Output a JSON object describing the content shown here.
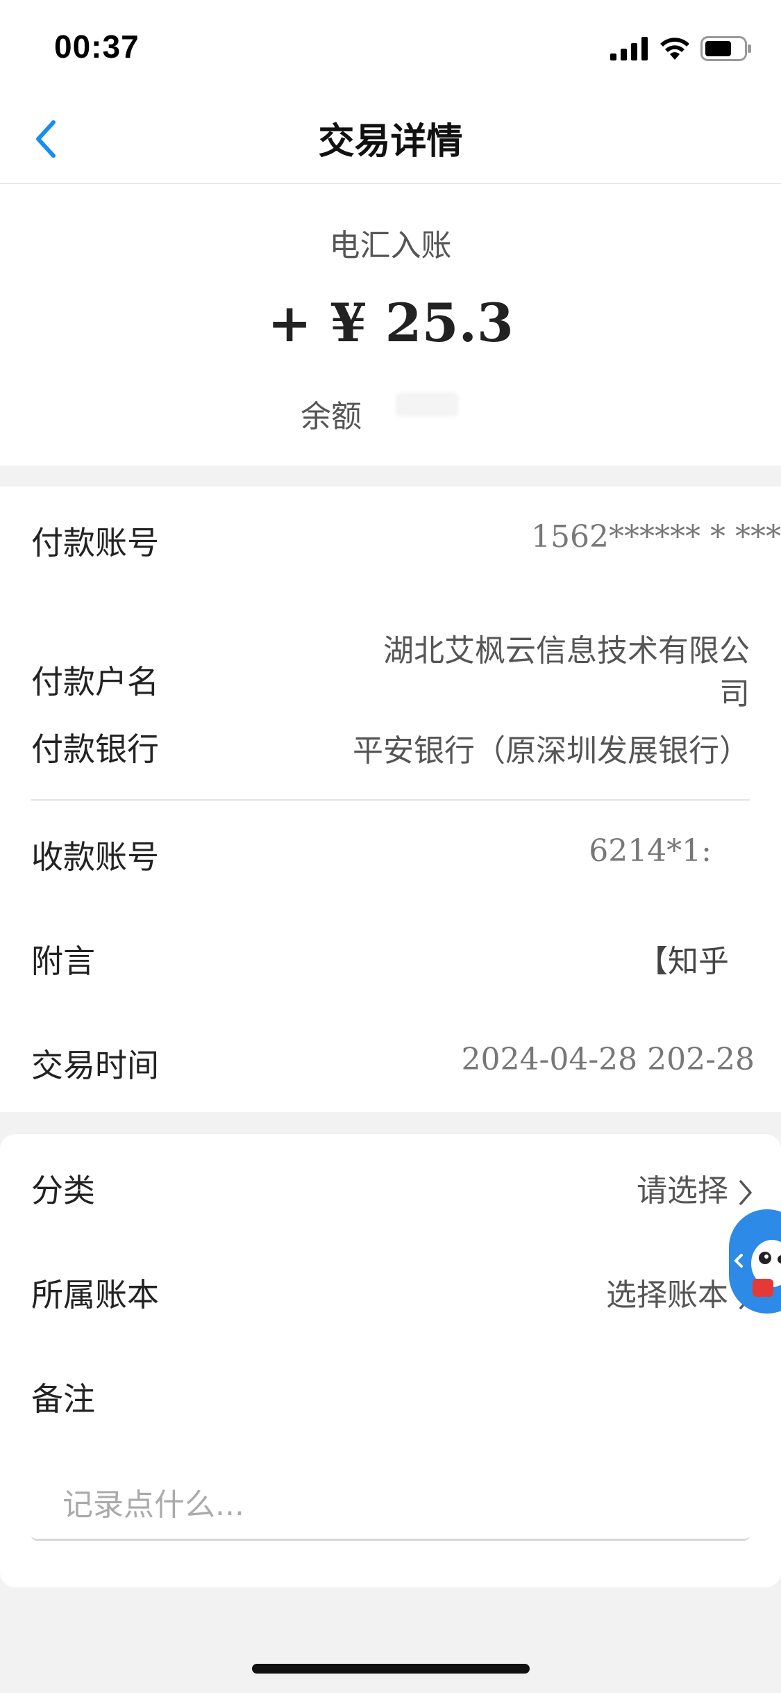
{
  "status_bar": {
    "time": "00:37"
  },
  "nav": {
    "title": "交易详情"
  },
  "summary": {
    "type": "电汇入账",
    "amount": "+ ¥ 25.3",
    "balance_label": "余额"
  },
  "details": [
    {
      "label": "付款账号",
      "value": "1562****** * ***"
    },
    {
      "label": "付款户名",
      "value_line1": "湖北艾枫云信息技术有限公",
      "value_line2": "司"
    },
    {
      "label": "付款银行",
      "value": "平安银行（原深圳发展银行）"
    },
    {
      "label": "收款账号",
      "value": "6214*1:"
    },
    {
      "label": "附言",
      "value": "【知乎"
    },
    {
      "label": "交易时间",
      "value": "2024-04-28 202-28"
    }
  ],
  "settings": {
    "category": {
      "label": "分类",
      "value": "请选择"
    },
    "ledger": {
      "label": "所属账本",
      "value": "选择账本"
    },
    "note": {
      "label": "备注",
      "placeholder": "记录点什么..."
    }
  },
  "colors": {
    "accent": "#1a8cf0",
    "assistant_bg": "#2d8ae6"
  }
}
